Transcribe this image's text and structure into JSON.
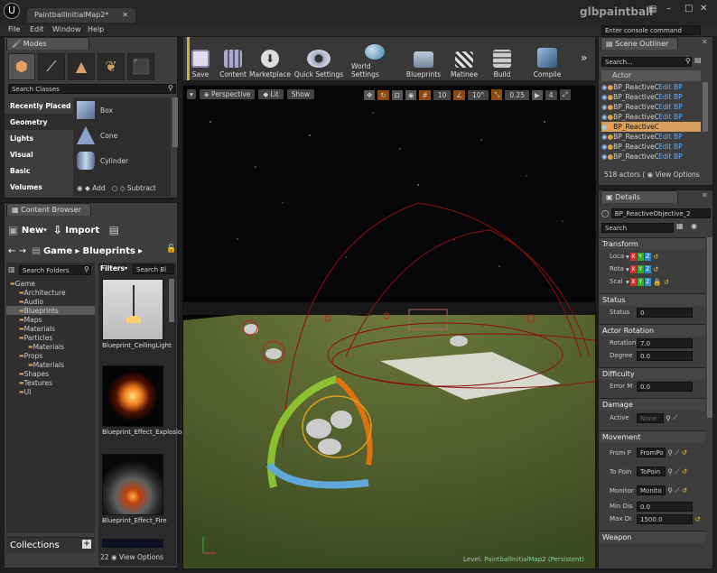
{
  "window": {
    "tab": "PaintballInitialMap2*",
    "app": "glbpaintball",
    "console_placeholder": "Enter console command"
  },
  "menu": [
    "File",
    "Edit",
    "Window",
    "Help"
  ],
  "modes": {
    "title": "Modes",
    "search_placeholder": "Search Classes",
    "categories": [
      "Recently Placed",
      "Geometry",
      "Lights",
      "Visual",
      "Basic",
      "Volumes"
    ],
    "items": [
      "Box",
      "Cone",
      "Cylinder"
    ],
    "add": "Add",
    "subtract": "Subtract"
  },
  "toolbar": [
    "Save",
    "Content",
    "Marketplace",
    "Quick Settings",
    "World Settings",
    "Blueprints",
    "Matinee",
    "Build",
    "Compile"
  ],
  "viewport": {
    "perspective": "Perspective",
    "lit": "Lit",
    "show": "Show",
    "grid": "10",
    "angle": "10°",
    "scale": "0.25",
    "cam": "4",
    "level_label": "Level:",
    "level_name": "PaintballInitialMap2 (Persistent)"
  },
  "content_browser": {
    "title": "Content Browser",
    "new": "New",
    "import": "Import",
    "breadcrumb": [
      "Game",
      "Blueprints"
    ],
    "search_folders": "Search Folders",
    "filters": "Filters",
    "search_bp": "Search Bl",
    "folders": [
      "Game",
      "Architecture",
      "Audio",
      "Blueprints",
      "Maps",
      "Materials",
      "Particles",
      "Materials",
      "Props",
      "Materials",
      "Shapes",
      "Textures",
      "UI"
    ],
    "assets": [
      "Blueprint_CeilingLight",
      "Blueprint_Effect_Explosion",
      "Blueprint_Effect_Fire"
    ],
    "count": "22",
    "view_options": "View Options",
    "collections": "Collections"
  },
  "outliner": {
    "title": "Scene Outliner",
    "search": "Search...",
    "column": "Actor",
    "rows": [
      "BP_ReactiveO",
      "BP_ReactiveO",
      "BP_ReactiveO",
      "BP_ReactiveO",
      "BP_ReactiveO",
      "BP_ReactiveO",
      "BP_ReactiveO",
      "BP_ReactiveO"
    ],
    "edit": "Edit BP",
    "count": "518 actors (",
    "view_options": "View Options"
  },
  "details": {
    "title": "Details",
    "name": "BP_ReactiveObjective_2",
    "search": "Search",
    "transform": "Transform",
    "loc": "Loca",
    "rot": "Rota",
    "scale": "Scal",
    "status": "Status",
    "status_label": "Status",
    "status_val": "0",
    "actor_rotation": "Actor Rotation",
    "rotation": "Rotation",
    "rotation_val": "7.0",
    "degrees": "Degree",
    "degrees_val": "0.0",
    "difficulty": "Difficulty",
    "error": "Error M",
    "error_val": "0.0",
    "damage": "Damage",
    "active": "Active",
    "active_val": "None",
    "movement": "Movement",
    "from": "From P",
    "from_val": "FromPo",
    "to": "To Poin",
    "to_val": "ToPoin",
    "monitor": "Monitor",
    "monitor_val": "Monito",
    "min": "Min Dis",
    "min_val": "0.0",
    "max": "Max Di",
    "max_val": "1500.0",
    "weapon": "Weapon"
  }
}
